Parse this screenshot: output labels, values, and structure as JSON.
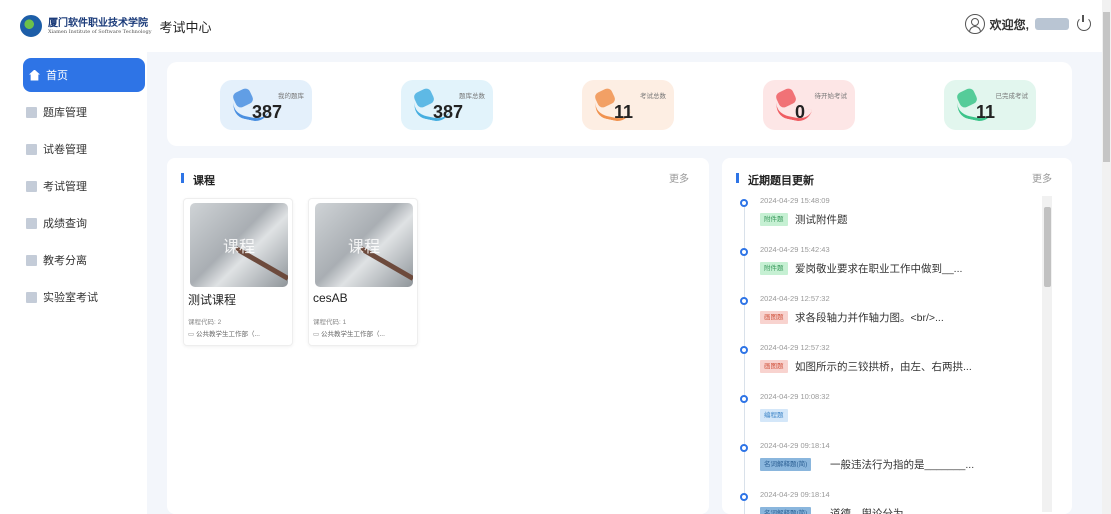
{
  "header": {
    "logo_text": "厦门软件职业技术学院",
    "logo_subtext": "Xiamen Institute of Software Technology",
    "app_title": "考试中心",
    "welcome": "欢迎您,",
    "power_icon": "power-icon"
  },
  "sidebar": {
    "items": [
      {
        "label": "首页",
        "icon": "home-icon",
        "active": true
      },
      {
        "label": "题库管理",
        "icon": "question-bank-icon"
      },
      {
        "label": "试卷管理",
        "icon": "paper-icon"
      },
      {
        "label": "考试管理",
        "icon": "exam-icon"
      },
      {
        "label": "成绩查询",
        "icon": "score-icon"
      },
      {
        "label": "教考分离",
        "icon": "separation-icon"
      },
      {
        "label": "实验室考试",
        "icon": "lab-icon"
      }
    ]
  },
  "stats": [
    {
      "label": "我的题库",
      "value": "387",
      "bg": "#e4f0fb",
      "accent": "#4a8fe0"
    },
    {
      "label": "题库总数",
      "value": "387",
      "bg": "#e2f3fb",
      "accent": "#46aee0"
    },
    {
      "label": "考试总数",
      "value": "11",
      "bg": "#fdeee3",
      "accent": "#f0924f"
    },
    {
      "label": "待开始考试",
      "value": "0",
      "bg": "#fde6e6",
      "accent": "#ef5d62"
    },
    {
      "label": "已完成考试",
      "value": "11",
      "bg": "#e2f6ee",
      "accent": "#3cc48a"
    }
  ],
  "courses_panel": {
    "title": "课程",
    "more": "更多",
    "courses": [
      {
        "image_label": "课程",
        "name": "测试课程",
        "code": "课程代码: 2",
        "dept": "公共教学生工作部（..."
      },
      {
        "image_label": "课程",
        "name": "cesAB",
        "code": "课程代码: 1",
        "dept": "公共教学生工作部（..."
      }
    ]
  },
  "updates_panel": {
    "title": "近期题目更新",
    "more": "更多",
    "items": [
      {
        "time": "2024-04-29 15:48:09",
        "badge": "附件题",
        "badge_class": "b-green",
        "text": "测试附件题"
      },
      {
        "time": "2024-04-29 15:42:43",
        "badge": "附件题",
        "badge_class": "b-green",
        "text": "爱岗敬业要求在职业工作中做到__..."
      },
      {
        "time": "2024-04-29 12:57:32",
        "badge": "画图题",
        "badge_class": "b-red",
        "text": "求各段轴力并作轴力图。<br/>..."
      },
      {
        "time": "2024-04-29 12:57:32",
        "badge": "画图题",
        "badge_class": "b-red",
        "text": "如图所示的三铰拱桥，由左、右两拱..."
      },
      {
        "time": "2024-04-29 10:08:32",
        "badge": "编程题",
        "badge_class": "b-blue",
        "text": ""
      },
      {
        "time": "2024-04-29 09:18:14",
        "badge": "名词解释题(简)",
        "badge_class": "b-blue2",
        "text": "一般违法行为指的是_______..."
      },
      {
        "time": "2024-04-29 09:18:14",
        "badge": "名词解释题(简)",
        "badge_class": "b-blue2",
        "text": "道德、舆论分为..."
      }
    ]
  }
}
